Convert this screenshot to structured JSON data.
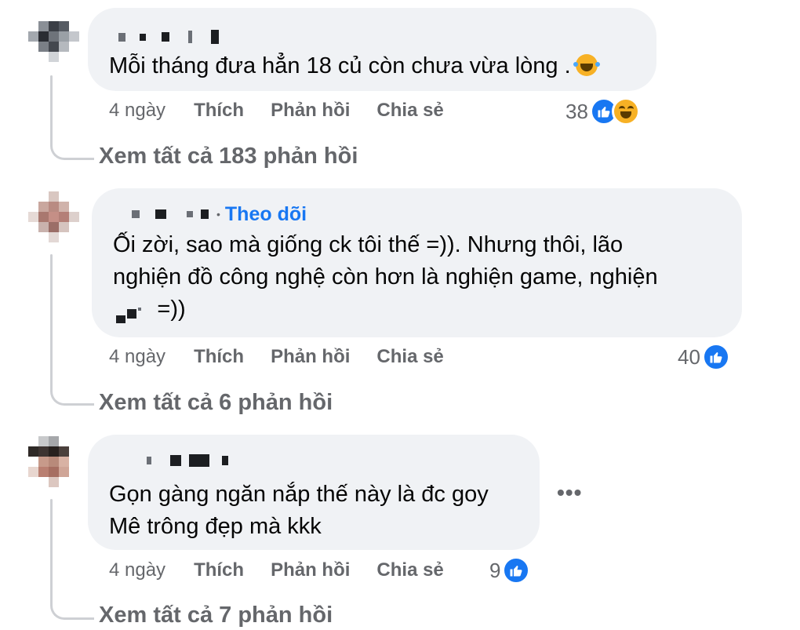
{
  "comments": [
    {
      "text": "Mỗi tháng đưa hẳn 18 củ còn chưa vừa lòng .",
      "time": "4 ngày",
      "like": "Thích",
      "reply": "Phản hồi",
      "share": "Chia sẻ",
      "reaction_count": "38",
      "reactions": [
        "like-icon",
        "haha-icon"
      ],
      "view_replies": "Xem tất cả 183 phản hồi"
    },
    {
      "follow": "Theo dõi",
      "text": "Ối zời, sao mà giống ck tôi thế =)). Nhưng thôi, lão\nnghiện đồ công nghệ còn hơn là nghiện game, nghiện\n       =))",
      "time": "4 ngày",
      "like": "Thích",
      "reply": "Phản hồi",
      "share": "Chia sẻ",
      "reaction_count": "40",
      "reactions": [
        "like-icon"
      ],
      "view_replies": "Xem tất cả 6 phản hồi"
    },
    {
      "text": "Gọn gàng ngăn nắp thế này là đc goy\nMê trông đẹp mà kkk",
      "time": "4 ngày",
      "like": "Thích",
      "reply": "Phản hồi",
      "share": "Chia sẻ",
      "reaction_count": "9",
      "reactions": [
        "like-icon"
      ],
      "more": "•••",
      "view_replies": "Xem tất cả 7 phản hồi"
    }
  ],
  "colors": {
    "bubble": "#f0f2f5",
    "link_blue": "#1877f2",
    "secondary_text": "#65676b",
    "thread_line": "#ced0d4"
  }
}
